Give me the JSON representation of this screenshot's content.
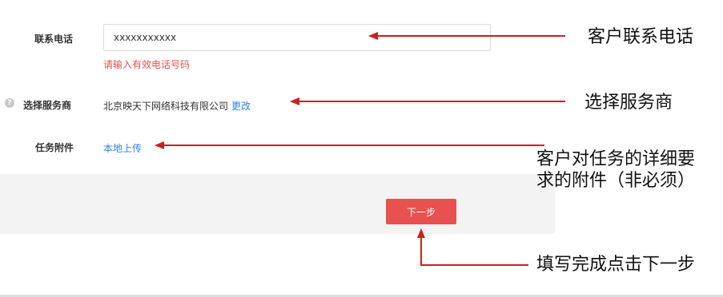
{
  "form": {
    "phone": {
      "label": "联系电话",
      "value": "xxxxxxxxxxx",
      "error": "请输入有效电话号码"
    },
    "provider": {
      "label": "选择服务商",
      "value": "北京映天下网络科技有限公司",
      "change_label": "更改",
      "help_icon": "?"
    },
    "attachment": {
      "label": "任务附件",
      "upload_label": "本地上传"
    }
  },
  "footer": {
    "next_label": "下一步"
  },
  "annotations": {
    "phone": "客户联系电话",
    "provider": "选择服务商",
    "attachment_line1": "客户对任务的详细要",
    "attachment_line2": "求的附件（非必须）",
    "next": "填写完成点击下一步"
  },
  "colors": {
    "accent": "#e8514f",
    "link": "#2f80ed",
    "arrow": "#cc1f1f"
  }
}
